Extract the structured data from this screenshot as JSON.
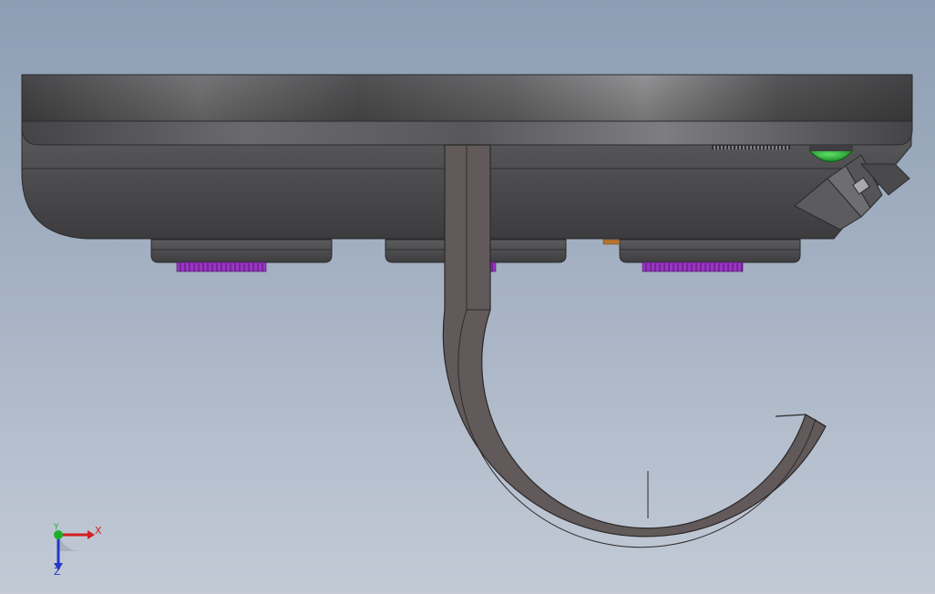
{
  "viewport": {
    "background_top": "#8d9db3",
    "background_bottom": "#c3cad6"
  },
  "model": {
    "body_color": "#4d4d4f",
    "cable_color": "#625a5a",
    "connector_color": "#9a35c4",
    "indicator_color": "#1e9b2a"
  },
  "triad": {
    "x_label": "X",
    "y_label": "Y",
    "z_label": "Z",
    "x_color": "#d21f1f",
    "y_color": "#1fae2a",
    "z_color": "#2338c8"
  }
}
